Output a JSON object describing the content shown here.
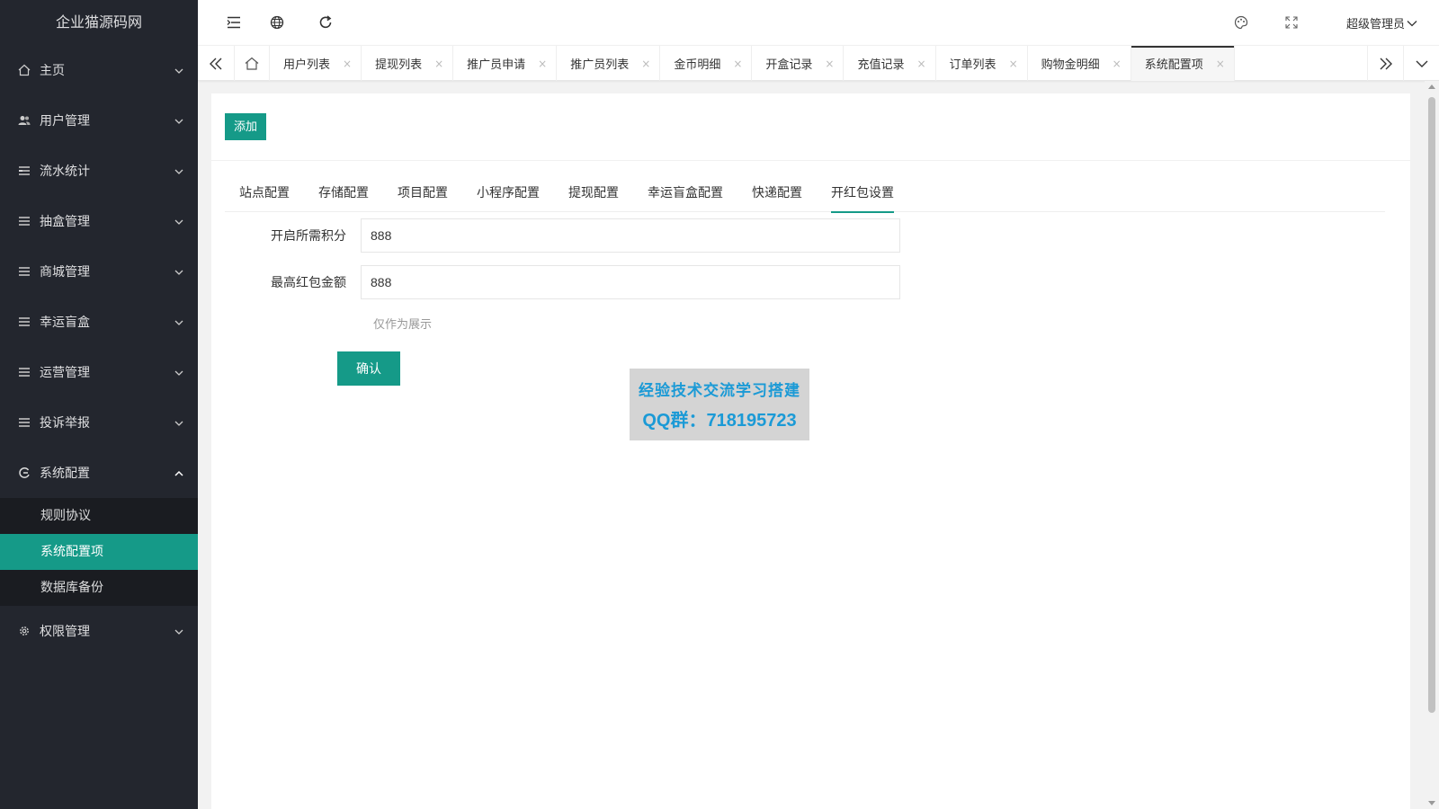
{
  "app": {
    "logo": "企业猫源码网"
  },
  "sidebar": {
    "items": [
      {
        "label": "主页",
        "icon": "home-icon"
      },
      {
        "label": "用户管理",
        "icon": "users-icon"
      },
      {
        "label": "流水统计",
        "icon": "list-icon"
      },
      {
        "label": "抽盒管理",
        "icon": "list-icon"
      },
      {
        "label": "商城管理",
        "icon": "list-icon"
      },
      {
        "label": "幸运盲盒",
        "icon": "list-icon"
      },
      {
        "label": "运营管理",
        "icon": "list-icon"
      },
      {
        "label": "投诉举报",
        "icon": "list-icon"
      },
      {
        "label": "系统配置",
        "icon": "settings-cycle-icon"
      },
      {
        "label": "权限管理",
        "icon": "gear-icon"
      }
    ],
    "subitems": [
      {
        "label": "规则协议"
      },
      {
        "label": "系统配置项"
      },
      {
        "label": "数据库备份"
      }
    ]
  },
  "header": {
    "admin_label": "超级管理员"
  },
  "tabs": [
    {
      "label": "用户列表"
    },
    {
      "label": "提现列表"
    },
    {
      "label": "推广员申请"
    },
    {
      "label": "推广员列表"
    },
    {
      "label": "金币明细"
    },
    {
      "label": "开盒记录"
    },
    {
      "label": "充值记录"
    },
    {
      "label": "订单列表"
    },
    {
      "label": "购物金明细"
    },
    {
      "label": "系统配置项"
    }
  ],
  "tab_close_glyph": "×",
  "main": {
    "add_button": "添加",
    "form_tabs": [
      {
        "label": "站点配置"
      },
      {
        "label": "存储配置"
      },
      {
        "label": "项目配置"
      },
      {
        "label": "小程序配置"
      },
      {
        "label": "提现配置"
      },
      {
        "label": "幸运盲盒配置"
      },
      {
        "label": "快递配置"
      },
      {
        "label": "开红包设置"
      }
    ],
    "fields": [
      {
        "label": "开启所需积分",
        "value": "888"
      },
      {
        "label": "最高红包金额",
        "value": "888"
      }
    ],
    "hint": "仅作为展示",
    "confirm_button": "确认"
  },
  "watermark": {
    "line1": "经验技术交流学习搭建",
    "line2": "QQ群：718195723"
  },
  "colors": {
    "accent": "#159a88",
    "sidebar_bg": "#23262e",
    "submenu_bg": "#1a1c21"
  }
}
